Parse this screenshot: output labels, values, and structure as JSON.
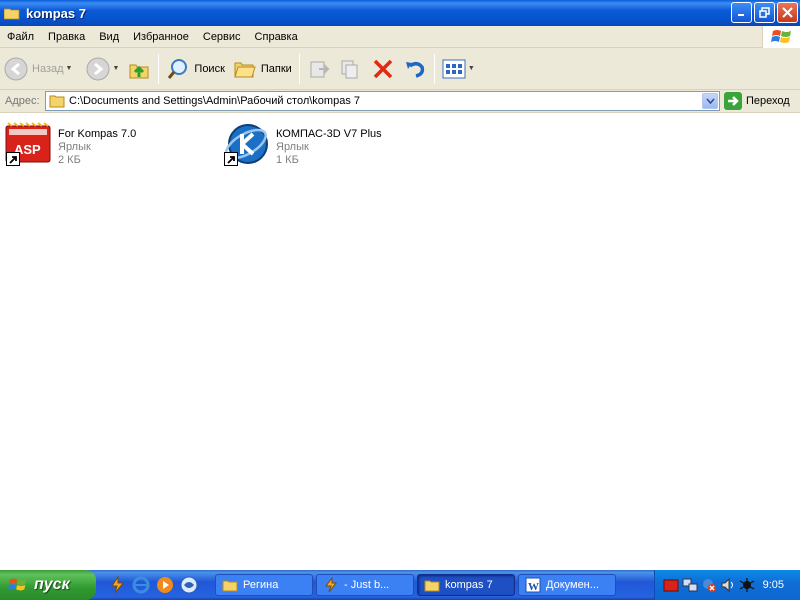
{
  "window": {
    "title": "kompas 7"
  },
  "menu": [
    "Файл",
    "Правка",
    "Вид",
    "Избранное",
    "Сервис",
    "Справка"
  ],
  "toolbar": {
    "back_label": "Назад",
    "search_label": "Поиск",
    "folders_label": "Папки"
  },
  "address": {
    "label": "Адрес:",
    "value": "C:\\Documents and Settings\\Admin\\Рабочий стол\\kompas 7",
    "go_label": "Переход"
  },
  "files": [
    {
      "name": "For Kompas 7.0",
      "type": "Ярлык",
      "size": "2 КБ",
      "icon": "asp-shortcut-icon"
    },
    {
      "name": "КОМПАС-3D V7 Plus",
      "type": "Ярлык",
      "size": "1 КБ",
      "icon": "kompas-shortcut-icon"
    }
  ],
  "taskbar": {
    "start_label": "пуск",
    "tasks": [
      {
        "label": "Регина",
        "icon": "folder-icon",
        "active": false
      },
      {
        "label": "- Just b...",
        "icon": "winamp-icon",
        "active": false
      },
      {
        "label": "kompas 7",
        "icon": "folder-icon",
        "active": true
      },
      {
        "label": "Докумен...",
        "icon": "word-icon",
        "active": false
      }
    ],
    "clock": "9:05"
  },
  "colors": {
    "title_bar": "#0a5fd8",
    "taskbar": "#2157d7",
    "start_button": "#319a31",
    "chrome": "#ece9d8"
  }
}
